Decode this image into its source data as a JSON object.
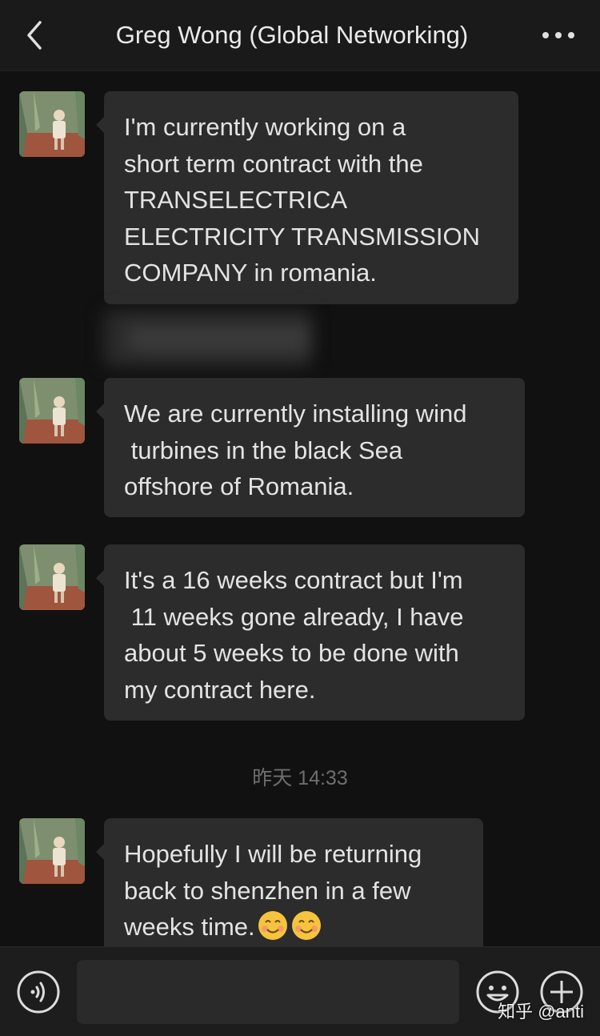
{
  "header": {
    "title": "Greg Wong (Global Networking)",
    "back_icon": "chevron-left-icon",
    "more_icon": "more-dots-icon"
  },
  "messages": [
    {
      "text": "I'm currently working on a\nshort term contract with the\nTRANSELECTRICA\nELECTRICITY TRANSMISSION\nCOMPANY in romania."
    },
    {
      "text": "We are currently installing wind\n turbines in the black Sea\noffshore of Romania."
    },
    {
      "text": "It's a 16 weeks contract but I'm\n 11 weeks gone already, I have\nabout 5 weeks to be done with\nmy contract here."
    },
    {
      "text": "Hopefully I will be returning\nback to shenzhen in a few\nweeks time."
    }
  ],
  "timestamp": "昨天 14:33",
  "input_bar": {
    "voice_icon": "voice-icon",
    "emoji_icon": "emoji-icon",
    "plus_icon": "plus-icon"
  },
  "watermark": "知乎 @anti",
  "colors": {
    "background": "#111111",
    "bubble": "#2c2c2c",
    "text": "#e3e3e3",
    "timestamp": "#6e6e6e"
  }
}
